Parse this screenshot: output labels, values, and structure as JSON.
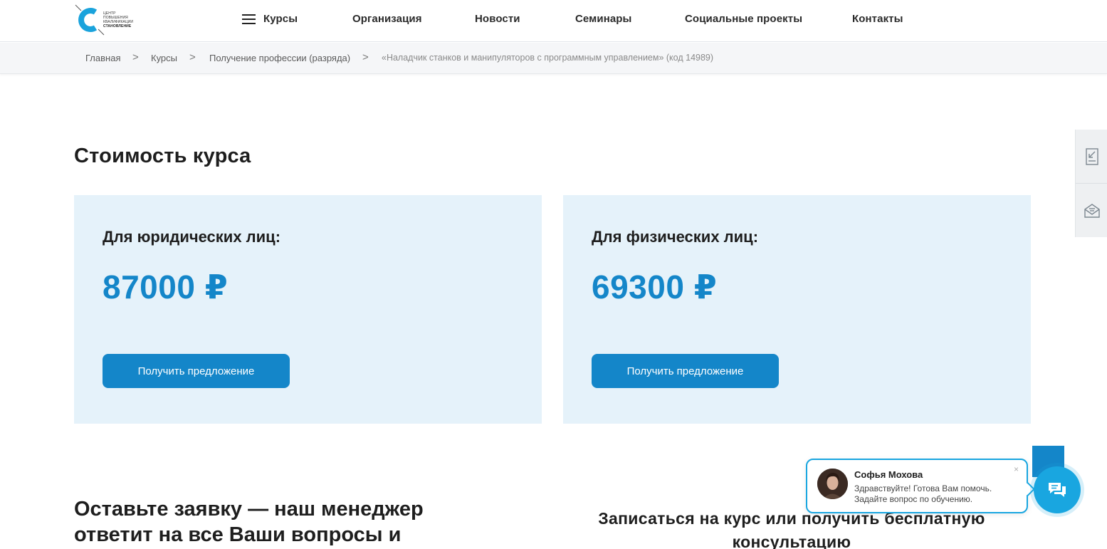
{
  "logo": {
    "lines": [
      "Центр",
      "повышения",
      "квалификации",
      "Становление"
    ]
  },
  "nav": {
    "courses": "Курсы",
    "organization": "Организация",
    "news": "Новости",
    "seminars": "Семинары",
    "social": "Социальные проекты",
    "contacts": "Контакты"
  },
  "breadcrumbs": [
    "Главная",
    "Курсы",
    "Получение профессии (разряда)",
    "«Наладчик станков и манипуляторов с программным управлением» (код 14989)"
  ],
  "breadcrumb_separator": ">",
  "pricing": {
    "title": "Стоимость курса",
    "cards": [
      {
        "label": "Для юридических лиц:",
        "price": "87000 ₽",
        "button": "Получить предложение"
      },
      {
        "label": "Для физических лиц:",
        "price": "69300 ₽",
        "button": "Получить предложение"
      }
    ]
  },
  "lead": {
    "title": "Оставьте заявку — наш менеджер ответит на все Ваши вопросы и"
  },
  "signup": {
    "title": "Записаться на курс или получить бесплатную консультацию"
  },
  "chat": {
    "name": "Софья Мохова",
    "message": "Здравствуйте! Готова Вам помочь. Задайте вопрос по обучению.",
    "close": "×"
  },
  "colors": {
    "accent": "#1486c9",
    "card_bg": "#e5f2fa",
    "chat_accent": "#19a6e0"
  },
  "icons": {
    "side_top": "download-doc-icon",
    "side_bottom": "mail-icon",
    "chat": "chat-icon"
  }
}
